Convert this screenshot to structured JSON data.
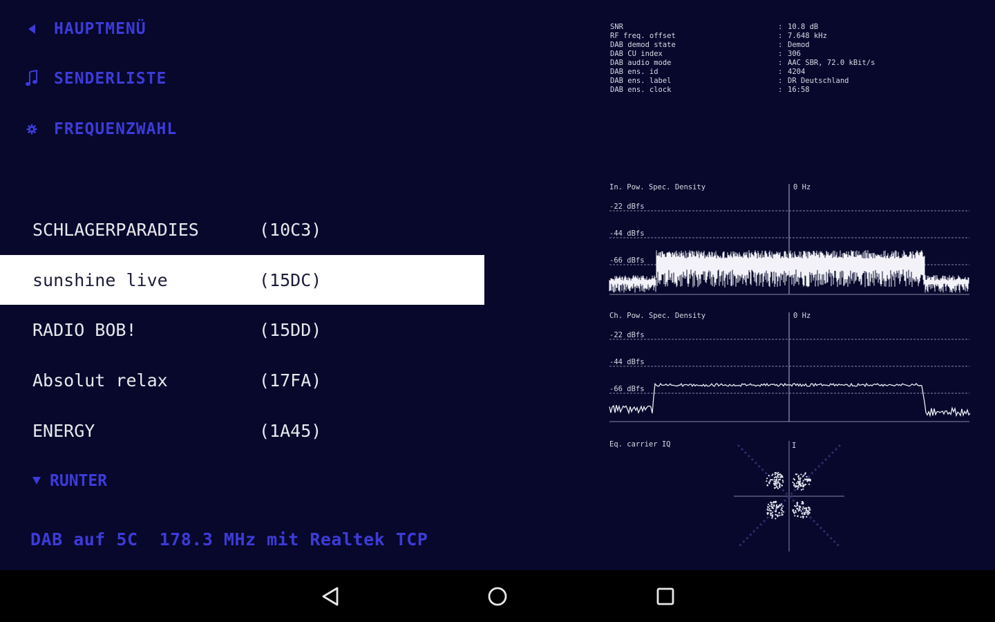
{
  "menu": [
    {
      "label": "HAUPTMENÜ",
      "icon": "arrow-left-icon"
    },
    {
      "label": "SENDERLISTE",
      "icon": "music-note-icon"
    },
    {
      "label": "FREQUENZWAHL",
      "icon": "gear-icon"
    }
  ],
  "stations": [
    {
      "name": "SCHLAGERPARADIES",
      "id": "(10C3)",
      "selected": false
    },
    {
      "name": "sunshine live",
      "id": "(15DC)",
      "selected": true
    },
    {
      "name": "RADIO BOB!",
      "id": "(15DD)",
      "selected": false
    },
    {
      "name": "Absolut relax",
      "id": "(17FA)",
      "selected": false
    },
    {
      "name": "ENERGY",
      "id": "(1A45)",
      "selected": false
    }
  ],
  "down_button": {
    "label": "RUNTER",
    "icon": "triangle-down-icon"
  },
  "status_line": "DAB auf 5C  178.3 MHz mit Realtek TCP",
  "info": [
    {
      "key": "SNR",
      "value": "10.8 dB"
    },
    {
      "key": "RF freq. offset",
      "value": "7.648 kHz"
    },
    {
      "key": "DAB demod state",
      "value": "Demod"
    },
    {
      "key": "DAB CU index",
      "value": "306"
    },
    {
      "key": "DAB audio mode",
      "value": "AAC SBR, 72.0 kBit/s"
    },
    {
      "key": "DAB ens. id",
      "value": "4204"
    },
    {
      "key": "DAB ens. label",
      "value": "DR Deutschland"
    },
    {
      "key": "DAB ens. clock",
      "value": "16:58"
    }
  ],
  "spectrum": {
    "in_title": "In. Pow. Spec. Density",
    "ch_title": "Ch. Pow. Spec. Density",
    "center_label": "0 Hz",
    "levels": [
      "-22 dBfs",
      "-44 dBfs",
      "-66 dBfs"
    ],
    "constellation_title": "Eq. carrier IQ",
    "constellation_axis": "I"
  },
  "colors": {
    "background": "#07082b",
    "accent": "#3d3bd9",
    "text": "#e8e8ee",
    "selected_bg": "#ffffff"
  },
  "navbar": [
    {
      "icon": "back-triangle-icon"
    },
    {
      "icon": "home-circle-icon"
    },
    {
      "icon": "recent-apps-square-icon"
    }
  ]
}
